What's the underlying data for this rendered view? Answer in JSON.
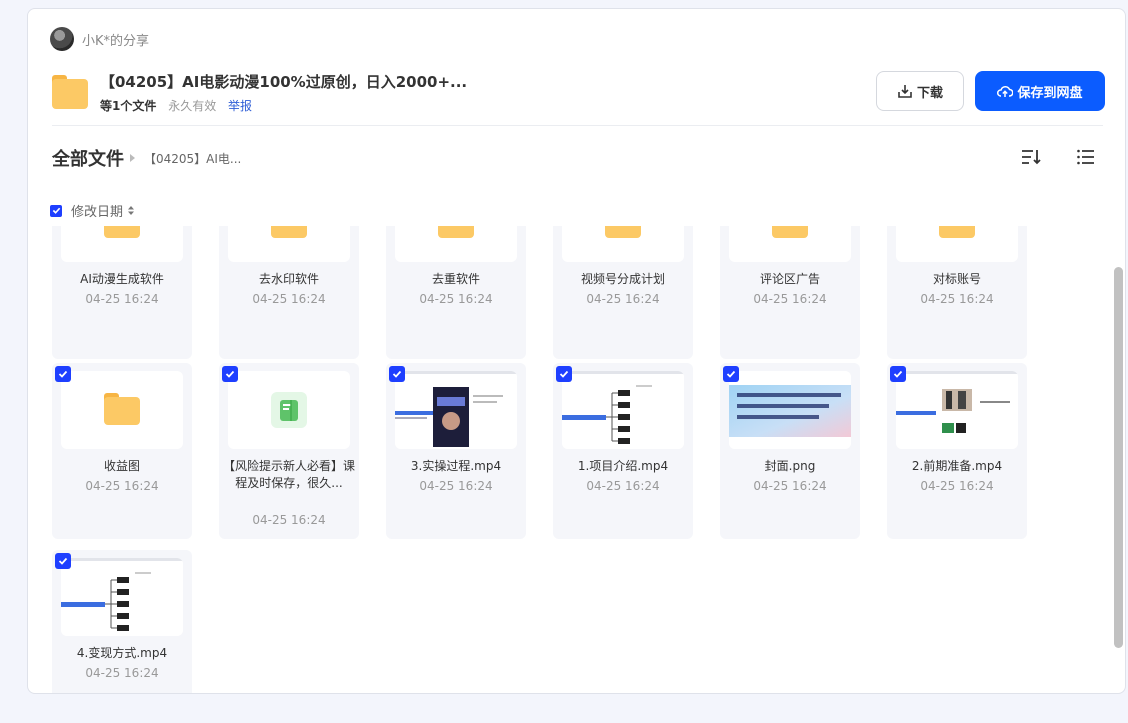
{
  "sharer": {
    "name": "小K*的分享"
  },
  "share": {
    "title": "【04205】AI电影动漫100%过原创，日入2000+...",
    "count": "等1个文件",
    "validity": "永久有效",
    "report": "举报"
  },
  "actions": {
    "download": "下载",
    "save": "保存到网盘"
  },
  "breadcrumb": {
    "root": "全部文件",
    "current": "【04205】AI电..."
  },
  "sort": {
    "label": "修改日期"
  },
  "icons": {
    "download": "download-icon",
    "save": "cloud-upload-icon",
    "sort_view": "sort-icon",
    "list_view": "list-icon",
    "folder": "folder-icon",
    "doc": "document-icon"
  },
  "colors": {
    "accent": "#0b5cff",
    "checkbox": "#1e3fff",
    "folder": "#fcc965"
  },
  "files": [
    {
      "name": "AI动漫生成软件",
      "date": "04-25 16:24",
      "kind": "folder",
      "checked": false
    },
    {
      "name": "去水印软件",
      "date": "04-25 16:24",
      "kind": "folder",
      "checked": false
    },
    {
      "name": "去重软件",
      "date": "04-25 16:24",
      "kind": "folder",
      "checked": false
    },
    {
      "name": "视频号分成计划",
      "date": "04-25 16:24",
      "kind": "folder",
      "checked": false
    },
    {
      "name": "评论区广告",
      "date": "04-25 16:24",
      "kind": "folder",
      "checked": false
    },
    {
      "name": "对标账号",
      "date": "04-25 16:24",
      "kind": "folder",
      "checked": false
    },
    {
      "name": "收益图",
      "date": "04-25 16:24",
      "kind": "folder",
      "checked": true
    },
    {
      "name": "【风险提示新人必看】课程及时保存，很久...",
      "date": "04-25 16:24",
      "kind": "doc",
      "checked": true
    },
    {
      "name": "3.实操过程.mp4",
      "date": "04-25 16:24",
      "kind": "video-screen",
      "checked": true
    },
    {
      "name": "1.项目介绍.mp4",
      "date": "04-25 16:24",
      "kind": "video-mindmap",
      "checked": true
    },
    {
      "name": "封面.png",
      "date": "04-25 16:24",
      "kind": "image-cover",
      "checked": true,
      "thumb_text": "AI电影动漫100%过原创，日入2000+，视频号分成计划最新项目，小白首选！"
    },
    {
      "name": "2.前期准备.mp4",
      "date": "04-25 16:24",
      "kind": "video-desktop",
      "checked": true
    },
    {
      "name": "4.变现方式.mp4",
      "date": "04-25 16:24",
      "kind": "video-mindmap",
      "checked": true
    }
  ]
}
